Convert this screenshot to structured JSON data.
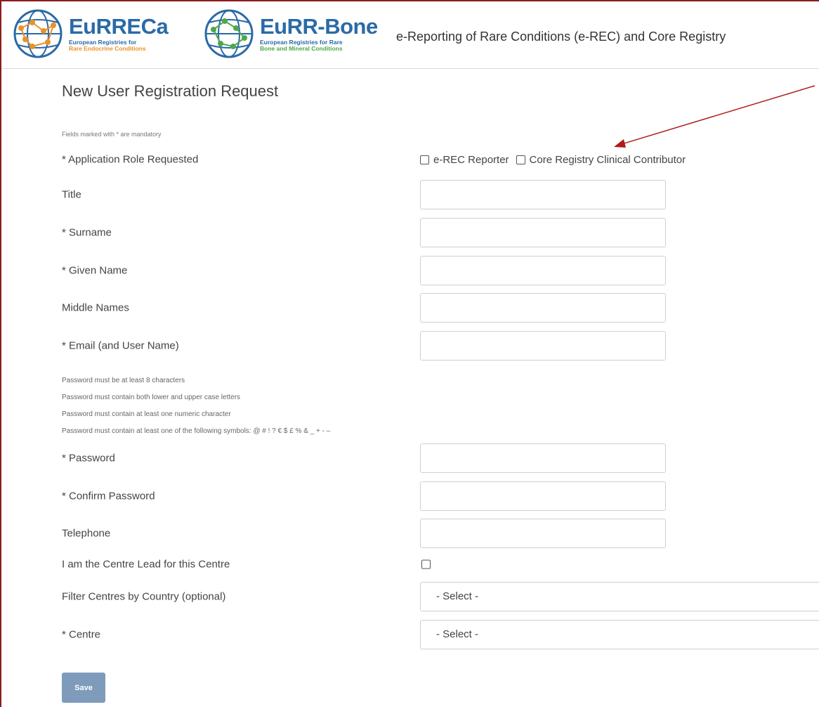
{
  "header": {
    "logo_eurreca": {
      "name": "EuRRECa",
      "sub1": "European Registries for",
      "sub2": "Rare Endocrine Conditions"
    },
    "logo_bone": {
      "name": "EuRR-Bone",
      "sub1": "European Registries for Rare",
      "sub2": "Bone and Mineral Conditions"
    },
    "app_title": "e-Reporting of Rare Conditions (e-REC) and Core Registry"
  },
  "form": {
    "title": "New User Registration Request",
    "mandatory_note": "Fields marked with * are mandatory",
    "role": {
      "label": "* Application Role Requested",
      "options": [
        "e-REC Reporter",
        "Core Registry Clinical Contributor"
      ]
    },
    "fields": {
      "title": "Title",
      "surname": "* Surname",
      "given_name": "* Given Name",
      "middle_names": "Middle Names",
      "email": "* Email (and User Name)",
      "password": "* Password",
      "confirm_password": "* Confirm Password",
      "telephone": "Telephone",
      "centre_lead": "I am the Centre Lead for this Centre",
      "country_filter": "Filter Centres by Country (optional)",
      "centre": "* Centre"
    },
    "password_rules": [
      "Password must be at least 8 characters",
      "Password must contain both lower and upper case letters",
      "Password must contain at least one numeric character",
      "Password must contain at least one of the following symbols: @ # ! ? € $ £ % & _ + - –"
    ],
    "select_placeholder": "- Select -",
    "save_label": "Save"
  },
  "colors": {
    "frame_border": "#8b1a1a",
    "brand_blue": "#2b6aa7",
    "save_button": "#7e9bbb",
    "annotation_arrow": "#b01c1c"
  }
}
